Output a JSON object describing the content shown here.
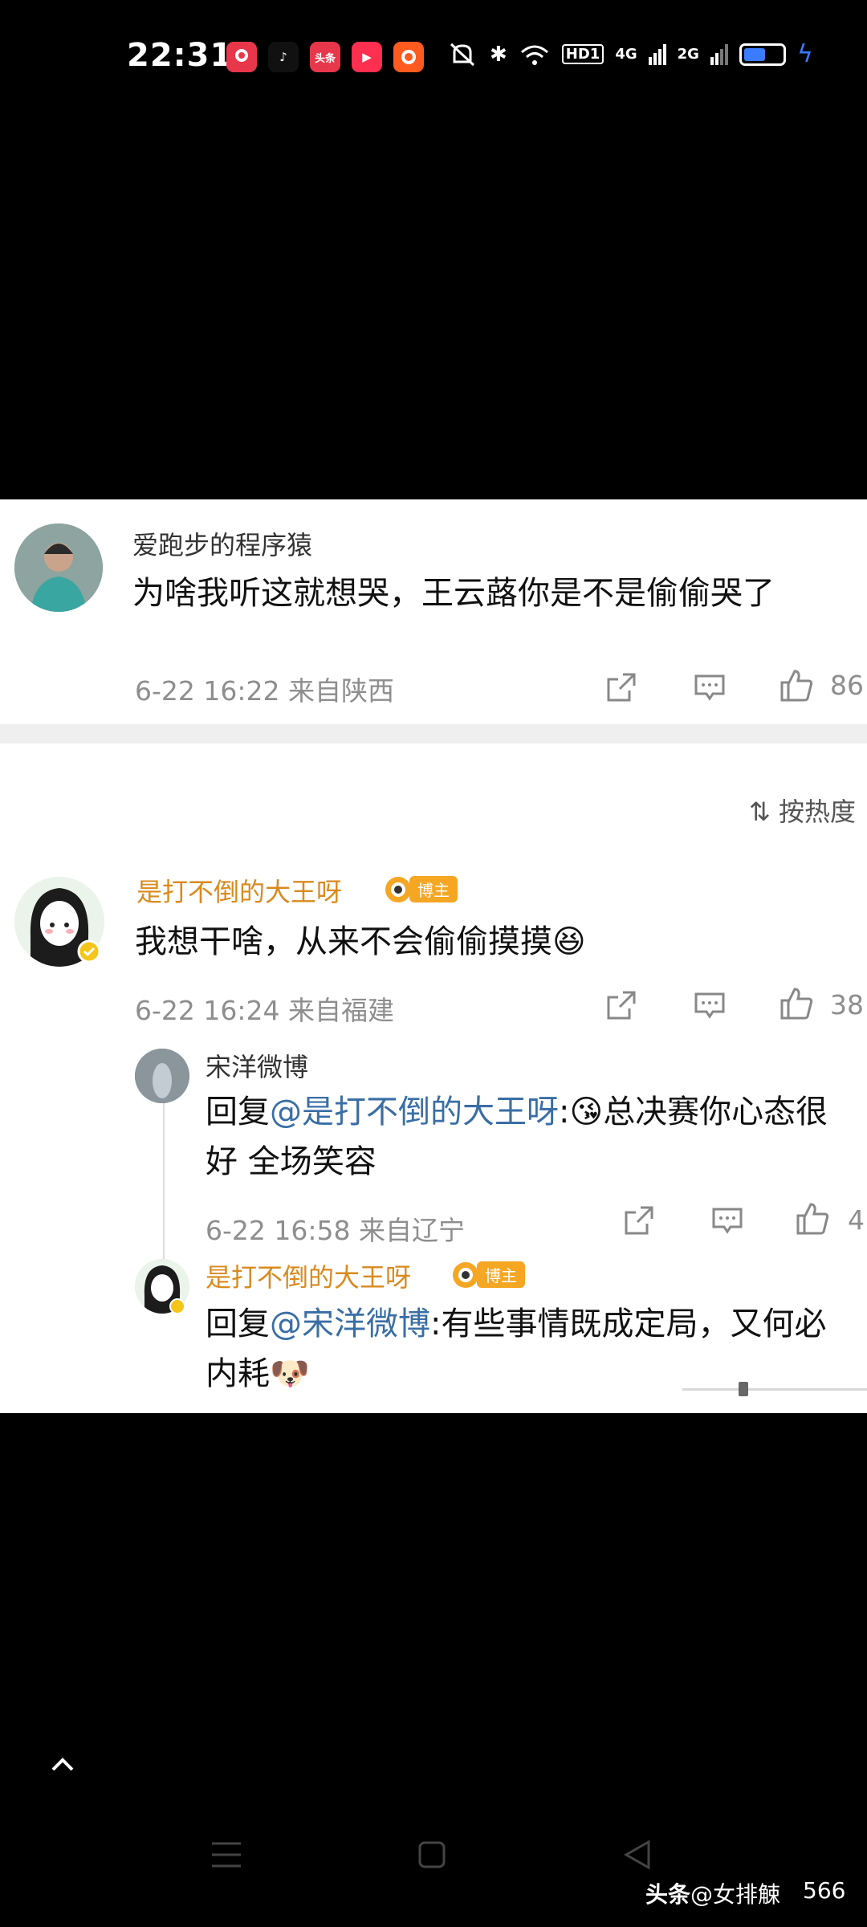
{
  "status_bar": {
    "time": "22:31",
    "app_icons": [
      {
        "name": "app-icon-1",
        "color": "#e8364a",
        "glyph": ""
      },
      {
        "name": "app-icon-tiktok",
        "color": "#111111",
        "glyph": "♪"
      },
      {
        "name": "app-icon-toutiao",
        "color": "#e8364a",
        "glyph": "头条"
      },
      {
        "name": "app-icon-video",
        "color": "#ff2f4f",
        "glyph": "▶"
      },
      {
        "name": "app-icon-taobao",
        "color": "#ff5a1f",
        "glyph": ""
      }
    ],
    "network_badge": "HD1",
    "signal_1": "4G",
    "signal_2": "2G"
  },
  "first_comment": {
    "username": "爱跑步的程序猿",
    "text": "为啥我听这就想哭，王云蕗你是不是偷偷哭了",
    "meta": "6-22 16:22  来自陕西",
    "likes": "86"
  },
  "sort_label": "按热度",
  "main_comment": {
    "username": "是打不倒的大王呀",
    "badge": "博主",
    "text": "我想干啥，从来不会偷偷摸摸",
    "meta": "6-22 16:24  来自福建",
    "likes": "38"
  },
  "replies": [
    {
      "username": "宋洋微博",
      "reply_prefix": "回复",
      "mention": "@是打不倒的大王呀",
      "text_line1": ":",
      "text_emoji_after": "总决赛你心态很",
      "text_line2": "好 全场笑容",
      "meta": "6-22 16:58  来自辽宁",
      "likes": "4"
    },
    {
      "username": "是打不倒的大王呀",
      "badge": "博主",
      "reply_prefix": "回复",
      "mention": "@宋洋微博",
      "text_line1": ":有些事情既成定局，又何必",
      "text_line2": "内耗"
    }
  ],
  "watermark": {
    "brand": "头条",
    "handle": "@女排觫",
    "number": "566"
  },
  "colors": {
    "accent": "#d98a1e",
    "mention": "#3a6ea5",
    "meta": "#8e8e8e"
  }
}
